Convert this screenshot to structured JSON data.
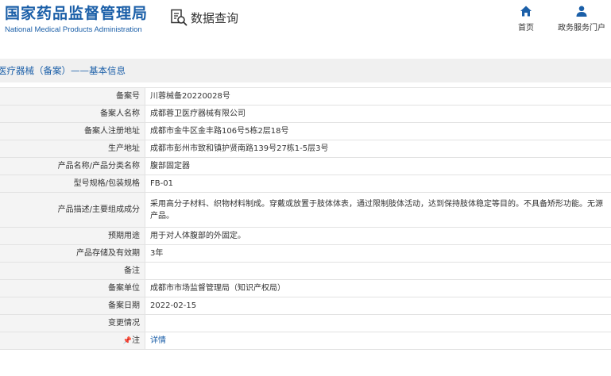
{
  "header": {
    "org_name_cn": "国家药品监督管理局",
    "org_name_en": "National Medical Products Administration",
    "query_label": "数据查询",
    "nav": [
      {
        "label": "首页",
        "icon": "home-icon"
      },
      {
        "label": "政务服务门户",
        "icon": "user-icon"
      }
    ]
  },
  "section": {
    "title": "医疗器械（备案）——基本信息"
  },
  "rows": [
    {
      "label": "备案号",
      "value": "川蓉械备20220028号"
    },
    {
      "label": "备案人名称",
      "value": "成都蓉卫医疗器械有限公司"
    },
    {
      "label": "备案人注册地址",
      "value": "成都市金牛区金丰路106号5栋2层18号"
    },
    {
      "label": "生产地址",
      "value": "成都市彭州市致和镇护贤南路139号27栋1-5层3号"
    },
    {
      "label": "产品名称/产品分类名称",
      "value": "腹部固定器"
    },
    {
      "label": "型号规格/包装规格",
      "value": "FB-01"
    },
    {
      "label": "产品描述/主要组成成分",
      "value": "采用高分子材料、织物材料制成。穿戴或放置于肢体体表，通过限制肢体活动，达到保持肢体稳定等目的。不具备矫形功能。无源产品。"
    },
    {
      "label": "预期用途",
      "value": "用于对人体腹部的外固定。"
    },
    {
      "label": "产品存储及有效期",
      "value": "3年"
    },
    {
      "label": "备注",
      "value": ""
    },
    {
      "label": "备案单位",
      "value": "成都市市场监督管理局（知识产权局）"
    },
    {
      "label": "备案日期",
      "value": "2022-02-15"
    },
    {
      "label": "变更情况",
      "value": ""
    },
    {
      "label": "注",
      "value": "详情"
    }
  ],
  "colors": {
    "brand": "#1b5fa8",
    "label_bg": "#f4f4f4",
    "section_bg": "#f0f0f0",
    "border": "#e2e2e2"
  }
}
